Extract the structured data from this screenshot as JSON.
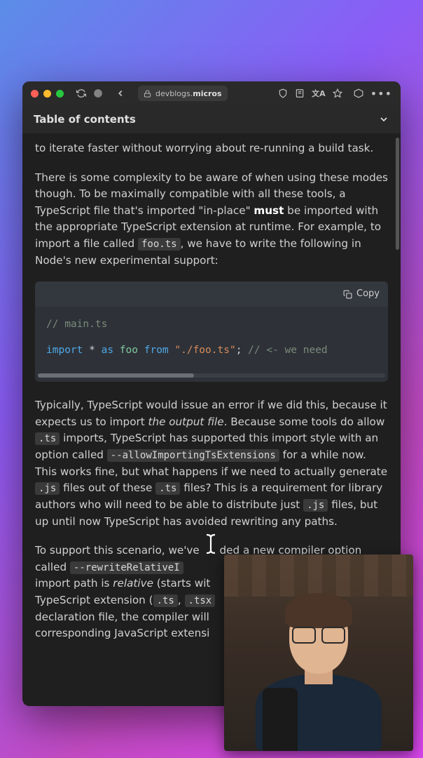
{
  "titlebar": {
    "url_host": "devblogs.",
    "url_bold": "micros"
  },
  "toc": {
    "title": "Table of contents"
  },
  "article": {
    "p1": "to iterate faster without worrying about re-running a build task.",
    "p2_pre": "There is some complexity to be aware of when using these modes though. To be maximally compatible with all these tools, a TypeScript file that's imported \"in-place\" ",
    "p2_must": "must",
    "p2_mid": " be imported with the appropriate TypeScript extension at runtime. For example, to import a file called ",
    "p2_foo": "foo.ts",
    "p2_end": ", we have to write the following in Node's new experimental support:",
    "code": {
      "copy": "Copy",
      "comment1": "// main.ts",
      "import": "import",
      "star": "*",
      "as": "as",
      "foo": "foo",
      "from": "from",
      "path": "\"./foo.ts\"",
      "semi": ";",
      "comment2": "// <- we need "
    },
    "p3_pre": "Typically, TypeScript would issue an error if we did this, because it expects us to import ",
    "p3_em": "the output file",
    "p3_mid1": ". Because some tools do allow ",
    "p3_ts": ".ts",
    "p3_mid2": " imports, TypeScript has supported this import style with an option called ",
    "p3_opt": "--allowImportingTsExtensions",
    "p3_mid3": " for a while now. This works fine, but what happens if we need to actually generate ",
    "p3_js1": ".js",
    "p3_mid4": " files out of these ",
    "p3_ts2": ".ts",
    "p3_mid5": " files? This is a requirement for library authors who will need to be able to distribute just ",
    "p3_js2": ".js",
    "p3_end": " files, but up until now TypeScript has avoided rewriting any paths.",
    "p4_pre": "To support this scenario, we've ",
    "p4_mid1": "ded a new compiler option called ",
    "p4_opt": "--rewriteRelativeI",
    "p4_mid2": " import path is ",
    "p4_em": "relative",
    "p4_mid3": " (starts wit",
    "p4_mid4": " TypeScript extension (",
    "p4_ts": ".ts",
    "p4_comma": ", ",
    "p4_tsx": ".tsx",
    "p4_mid5": " declaration file, the compiler will ",
    "p4_end": " corresponding JavaScript extensi"
  }
}
